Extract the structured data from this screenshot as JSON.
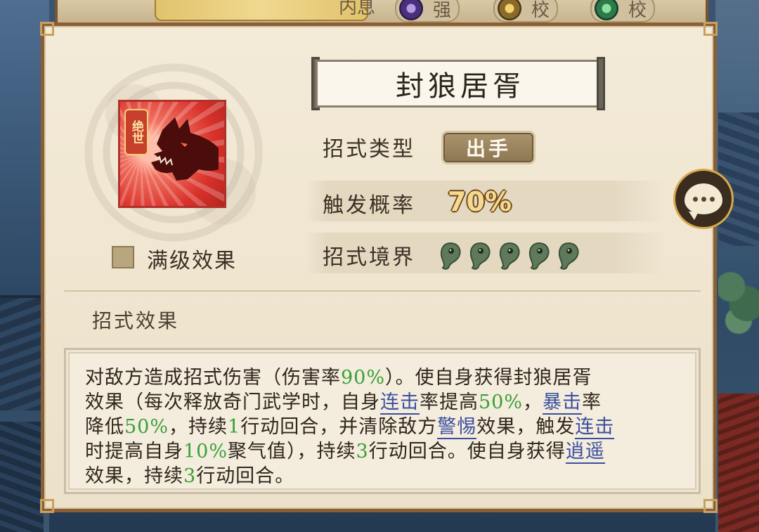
{
  "top_strip": {
    "labels": [
      "内息",
      "强",
      "校",
      "校"
    ]
  },
  "skill": {
    "name": "封狼居胥",
    "rank_badge": "绝世",
    "max_level_label": "满级效果",
    "rows": {
      "type_label": "招式类型",
      "type_value": "出手",
      "rate_label": "触发概率",
      "rate_value": "70%",
      "realm_label": "招式境界",
      "realm_level": 5
    },
    "effect_heading": "招式效果",
    "description_lines": [
      [
        "对敌方造成招式伤害（伤害率",
        "90%",
        "）。使自身获得封狼居胥"
      ],
      [
        "效果（每次释放奇门武学时，自身",
        "连击",
        "率提高",
        "50%",
        "，",
        "暴击",
        "率"
      ],
      [
        "降低",
        "50%",
        "，持续",
        "1",
        "行动回合，并清除敌方",
        "警惕",
        "效果，触发",
        "连击"
      ],
      [
        "时提高自身",
        "10%",
        "聚气值），持续",
        "3",
        "行动回合。使自身获得",
        "逍遥"
      ],
      [
        "效果，持续",
        "3",
        "行动回合。"
      ]
    ]
  },
  "colors": {
    "highlight_green": "#39a03a",
    "keyword_blue": "#3a4fa0",
    "panel_border": "#8a5f36",
    "icon_red": "#d9322b"
  },
  "icons": {
    "skill": "wolf-head-icon",
    "realm": "jade-magatama-icon",
    "chat": "chat-bubble-icon"
  }
}
